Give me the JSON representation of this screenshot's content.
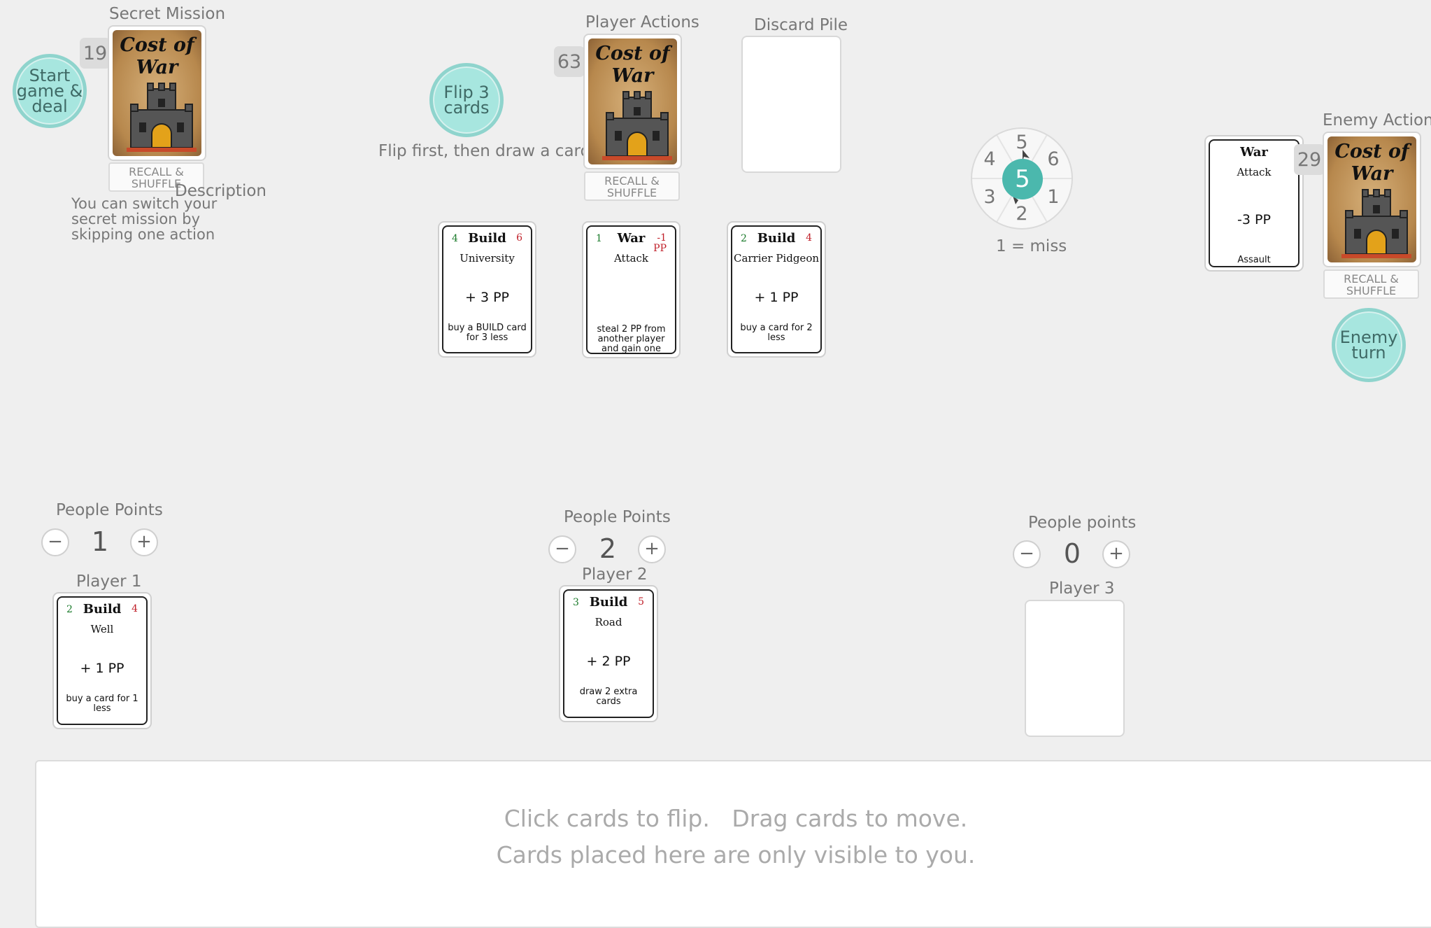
{
  "secret_mission": {
    "title": "Secret Mission",
    "count": "19",
    "deck_title": "Cost of War",
    "recall_label": "RECALL & SHUFFLE",
    "description_label": "Description",
    "description_text": "You can switch your secret mission by skipping one action"
  },
  "start_button": "Start game & deal",
  "flip_button": "Flip 3 cards",
  "flip_hint": "Flip first, then draw a card",
  "player_actions": {
    "title": "Player Actions",
    "count": "63",
    "deck_title": "Cost of War",
    "recall_label": "RECALL & SHUFFLE"
  },
  "discard_pile": {
    "title": "Discard Pile"
  },
  "dice": {
    "value": "5",
    "faces": [
      "5",
      "6",
      "1",
      "2",
      "3",
      "4"
    ],
    "hint": "1 = miss"
  },
  "enemy_actions": {
    "title": "Enemy Actions",
    "count": "29",
    "deck_title": "Cost of War",
    "recall_label": "RECALL & SHUFFLE",
    "turn_button": "Enemy turn",
    "card": {
      "type": "War",
      "name": "Attack",
      "pp": "-3 PP",
      "desc": "Assault"
    }
  },
  "market_cards": [
    {
      "cost": "4",
      "type": "Build",
      "value": "6",
      "name": "University",
      "pp": "+ 3 PP",
      "desc": "buy a BUILD card for 3 less"
    },
    {
      "cost": "1",
      "type": "War",
      "value": "-1 PP",
      "name": "Attack",
      "pp": "",
      "desc": "steal 2 PP from another player and gain one"
    },
    {
      "cost": "2",
      "type": "Build",
      "value": "4",
      "name": "Carrier Pidgeon",
      "pp": "+ 1 PP",
      "desc": "buy a card for 2 less"
    }
  ],
  "players": [
    {
      "pp_label": "People Points",
      "pp": "1",
      "name": "Player 1",
      "card": {
        "cost": "2",
        "type": "Build",
        "value": "4",
        "name": "Well",
        "pp": "+ 1 PP",
        "desc": "buy a card for 1 less"
      }
    },
    {
      "pp_label": "People Points",
      "pp": "2",
      "name": "Player 2",
      "card": {
        "cost": "3",
        "type": "Build",
        "value": "5",
        "name": "Road",
        "pp": "+ 2 PP",
        "desc": "draw 2 extra cards"
      }
    },
    {
      "pp_label": "People points",
      "pp": "0",
      "name": "Player 3"
    }
  ],
  "pp_controls": {
    "minus": "−",
    "plus": "+"
  },
  "private_area": {
    "line1": "Click cards to flip.   Drag cards to move.",
    "line2": "Cards placed here are only visible to you."
  },
  "colors": {
    "accent": "#a7e6df",
    "dice": "#4bb8ad",
    "cost_green": "#1a7a2a",
    "value_red": "#c0202a"
  }
}
